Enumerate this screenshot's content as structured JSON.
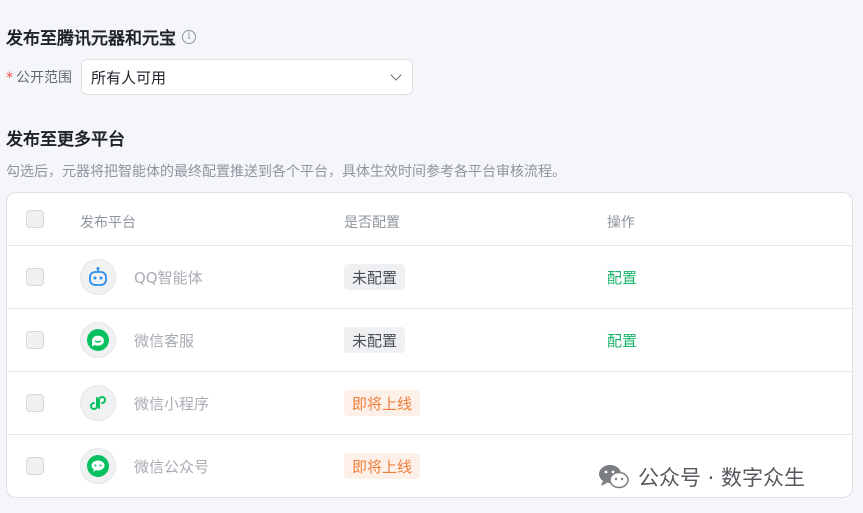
{
  "section1": {
    "title": "发布至腾讯元器和元宝",
    "info_icon": "info-icon",
    "scope_required": "*",
    "scope_label": "公开范围",
    "scope_value": "所有人可用"
  },
  "section2": {
    "title": "发布至更多平台",
    "description": "勾选后，元器将把智能体的最终配置推送到各个平台，具体生效时间参考各平台审核流程。"
  },
  "table": {
    "headers": {
      "platform": "发布平台",
      "configured": "是否配置",
      "action": "操作"
    },
    "rows": [
      {
        "platform": "QQ智能体",
        "icon": "qq-bot-icon",
        "status": "未配置",
        "status_type": "gray",
        "action": "配置"
      },
      {
        "platform": "微信客服",
        "icon": "wechat-service-icon",
        "status": "未配置",
        "status_type": "gray",
        "action": "配置"
      },
      {
        "platform": "微信小程序",
        "icon": "mini-program-icon",
        "status": "即将上线",
        "status_type": "orange",
        "action": ""
      },
      {
        "platform": "微信公众号",
        "icon": "wechat-official-icon",
        "status": "即将上线",
        "status_type": "orange",
        "action": ""
      }
    ]
  },
  "watermark": {
    "text": "公众号 · 数字众生"
  },
  "colors": {
    "accent_green": "#19b36b",
    "wechat_green": "#07c160",
    "qq_blue": "#2a8dea",
    "orange": "#ef7e3a",
    "required_red": "#f54a45"
  }
}
